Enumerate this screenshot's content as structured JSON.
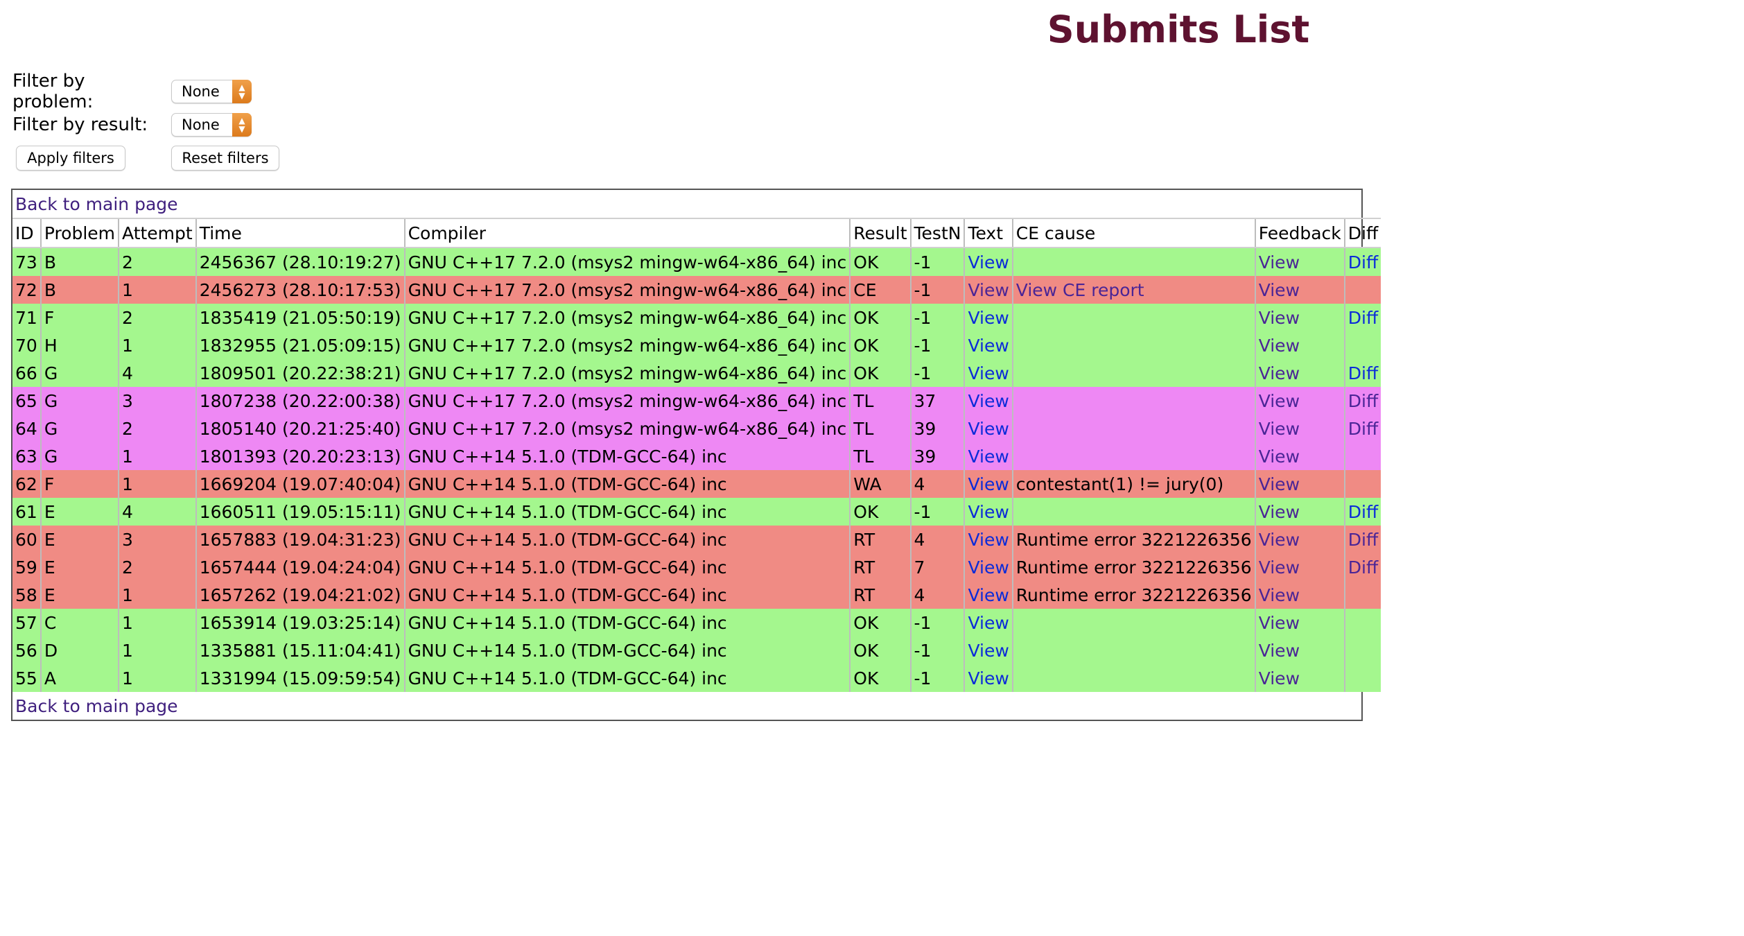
{
  "title": "Submits List",
  "filters": {
    "problem_label": "Filter by problem:",
    "problem_value": "None",
    "result_label": "Filter by result:",
    "result_value": "None",
    "apply_label": "Apply filters",
    "reset_label": "Reset filters"
  },
  "back_link": "Back to main page",
  "columns": [
    "ID",
    "Problem",
    "Attempt",
    "Time",
    "Compiler",
    "Result",
    "TestN",
    "Text",
    "CE cause",
    "Feedback",
    "Diff"
  ],
  "colors": {
    "ok": "#a4f78e",
    "error": "#f08b84",
    "tl": "#ee88f4",
    "title": "#5e1230",
    "link": "#0b2bd9",
    "visited_link": "#4a2596"
  },
  "rows": [
    {
      "id": "73",
      "problem": "B",
      "attempt": "2",
      "time": "2456367 (28.10:19:27)",
      "compiler": "GNU C++17 7.2.0 (msys2 mingw-w64-x86_64) inc",
      "result": "OK",
      "testn": "-1",
      "text": "View",
      "ce_cause": "",
      "feedback": "View",
      "diff": "Diff",
      "status": "ok"
    },
    {
      "id": "72",
      "problem": "B",
      "attempt": "1",
      "time": "2456273 (28.10:17:53)",
      "compiler": "GNU C++17 7.2.0 (msys2 mingw-w64-x86_64) inc",
      "result": "CE",
      "testn": "-1",
      "text": "View",
      "ce_cause": "View CE report",
      "feedback": "View",
      "diff": "",
      "status": "err"
    },
    {
      "id": "71",
      "problem": "F",
      "attempt": "2",
      "time": "1835419 (21.05:50:19)",
      "compiler": "GNU C++17 7.2.0 (msys2 mingw-w64-x86_64) inc",
      "result": "OK",
      "testn": "-1",
      "text": "View",
      "ce_cause": "",
      "feedback": "View",
      "diff": "Diff",
      "status": "ok"
    },
    {
      "id": "70",
      "problem": "H",
      "attempt": "1",
      "time": "1832955 (21.05:09:15)",
      "compiler": "GNU C++17 7.2.0 (msys2 mingw-w64-x86_64) inc",
      "result": "OK",
      "testn": "-1",
      "text": "View",
      "ce_cause": "",
      "feedback": "View",
      "diff": "",
      "status": "ok"
    },
    {
      "id": "66",
      "problem": "G",
      "attempt": "4",
      "time": "1809501 (20.22:38:21)",
      "compiler": "GNU C++17 7.2.0 (msys2 mingw-w64-x86_64) inc",
      "result": "OK",
      "testn": "-1",
      "text": "View",
      "ce_cause": "",
      "feedback": "View",
      "diff": "Diff",
      "status": "ok"
    },
    {
      "id": "65",
      "problem": "G",
      "attempt": "3",
      "time": "1807238 (20.22:00:38)",
      "compiler": "GNU C++17 7.2.0 (msys2 mingw-w64-x86_64) inc",
      "result": "TL",
      "testn": "37",
      "text": "View",
      "ce_cause": "",
      "feedback": "View",
      "diff": "Diff",
      "status": "tl"
    },
    {
      "id": "64",
      "problem": "G",
      "attempt": "2",
      "time": "1805140 (20.21:25:40)",
      "compiler": "GNU C++17 7.2.0 (msys2 mingw-w64-x86_64) inc",
      "result": "TL",
      "testn": "39",
      "text": "View",
      "ce_cause": "",
      "feedback": "View",
      "diff": "Diff",
      "status": "tl"
    },
    {
      "id": "63",
      "problem": "G",
      "attempt": "1",
      "time": "1801393 (20.20:23:13)",
      "compiler": "GNU C++14 5.1.0 (TDM-GCC-64) inc",
      "result": "TL",
      "testn": "39",
      "text": "View",
      "ce_cause": "",
      "feedback": "View",
      "diff": "",
      "status": "tl"
    },
    {
      "id": "62",
      "problem": "F",
      "attempt": "1",
      "time": "1669204 (19.07:40:04)",
      "compiler": "GNU C++14 5.1.0 (TDM-GCC-64) inc",
      "result": "WA",
      "testn": "4",
      "text": "View",
      "ce_cause": "contestant(1) != jury(0)",
      "feedback": "View",
      "diff": "",
      "status": "err"
    },
    {
      "id": "61",
      "problem": "E",
      "attempt": "4",
      "time": "1660511 (19.05:15:11)",
      "compiler": "GNU C++14 5.1.0 (TDM-GCC-64) inc",
      "result": "OK",
      "testn": "-1",
      "text": "View",
      "ce_cause": "",
      "feedback": "View",
      "diff": "Diff",
      "status": "ok"
    },
    {
      "id": "60",
      "problem": "E",
      "attempt": "3",
      "time": "1657883 (19.04:31:23)",
      "compiler": "GNU C++14 5.1.0 (TDM-GCC-64) inc",
      "result": "RT",
      "testn": "4",
      "text": "View",
      "ce_cause": "Runtime error 3221226356",
      "feedback": "View",
      "diff": "Diff",
      "status": "err"
    },
    {
      "id": "59",
      "problem": "E",
      "attempt": "2",
      "time": "1657444 (19.04:24:04)",
      "compiler": "GNU C++14 5.1.0 (TDM-GCC-64) inc",
      "result": "RT",
      "testn": "7",
      "text": "View",
      "ce_cause": "Runtime error 3221226356",
      "feedback": "View",
      "diff": "Diff",
      "status": "err"
    },
    {
      "id": "58",
      "problem": "E",
      "attempt": "1",
      "time": "1657262 (19.04:21:02)",
      "compiler": "GNU C++14 5.1.0 (TDM-GCC-64) inc",
      "result": "RT",
      "testn": "4",
      "text": "View",
      "ce_cause": "Runtime error 3221226356",
      "feedback": "View",
      "diff": "",
      "status": "err"
    },
    {
      "id": "57",
      "problem": "C",
      "attempt": "1",
      "time": "1653914 (19.03:25:14)",
      "compiler": "GNU C++14 5.1.0 (TDM-GCC-64) inc",
      "result": "OK",
      "testn": "-1",
      "text": "View",
      "ce_cause": "",
      "feedback": "View",
      "diff": "",
      "status": "ok"
    },
    {
      "id": "56",
      "problem": "D",
      "attempt": "1",
      "time": "1335881 (15.11:04:41)",
      "compiler": "GNU C++14 5.1.0 (TDM-GCC-64) inc",
      "result": "OK",
      "testn": "-1",
      "text": "View",
      "ce_cause": "",
      "feedback": "View",
      "diff": "",
      "status": "ok"
    },
    {
      "id": "55",
      "problem": "A",
      "attempt": "1",
      "time": "1331994 (15.09:59:54)",
      "compiler": "GNU C++14 5.1.0 (TDM-GCC-64) inc",
      "result": "OK",
      "testn": "-1",
      "text": "View",
      "ce_cause": "",
      "feedback": "View",
      "diff": "",
      "status": "ok"
    }
  ]
}
